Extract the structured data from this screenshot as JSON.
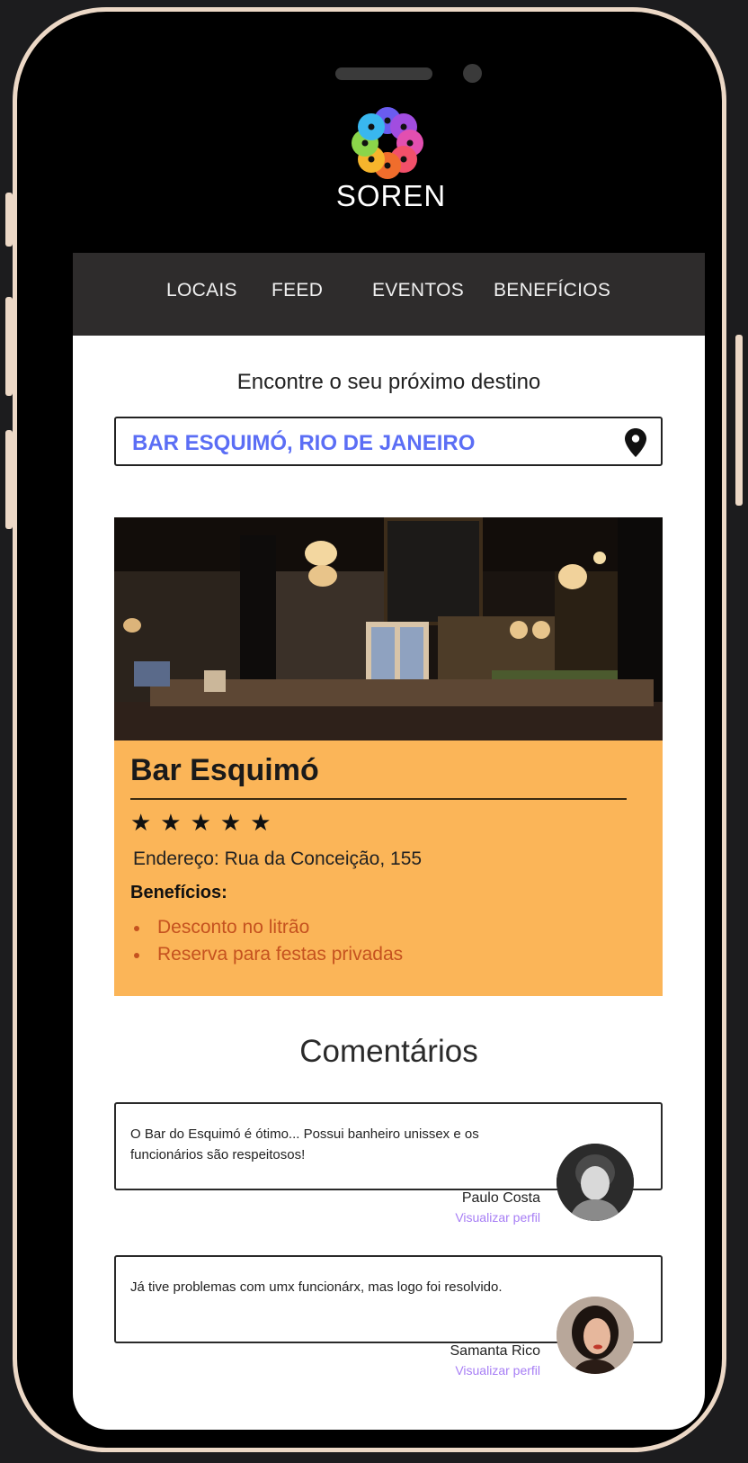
{
  "app": {
    "brand": "SOREN"
  },
  "nav": {
    "items": [
      "LOCAIS",
      "FEED",
      "EVENTOS",
      "BENEFÍCIOS"
    ]
  },
  "search": {
    "title": "Encontre o seu próximo destino",
    "value": "BAR ESQUIMÓ, RIO DE JANEIRO"
  },
  "place": {
    "name": "Bar Esquimó",
    "rating": 5,
    "stars": "★★★★★",
    "address": "Endereço: Rua da Conceição, 155",
    "benefits_label": "Benefícios:",
    "benefits": [
      "Desconto no litrão",
      "Reserva para festas privadas"
    ]
  },
  "comments": {
    "title": "Comentários",
    "items": [
      {
        "text": "O Bar do Esquimó é ótimo... Possui banheiro unissex e os funcionários são respeitosos!",
        "author": "Paulo Costa",
        "link": "Visualizar perfil"
      },
      {
        "text": "Já tive problemas com umx funcionárx, mas logo foi resolvido.",
        "author": "Samanta Rico",
        "link": "Visualizar perfil"
      }
    ]
  },
  "colors": {
    "card": "#fbb558",
    "search_text": "#5b6ef5",
    "link": "#a77ef5",
    "nav": "#2e2c2c"
  },
  "icons": {
    "search": "location-pin-icon",
    "rating": "star-icon",
    "logo": "soren-flower-logo"
  }
}
